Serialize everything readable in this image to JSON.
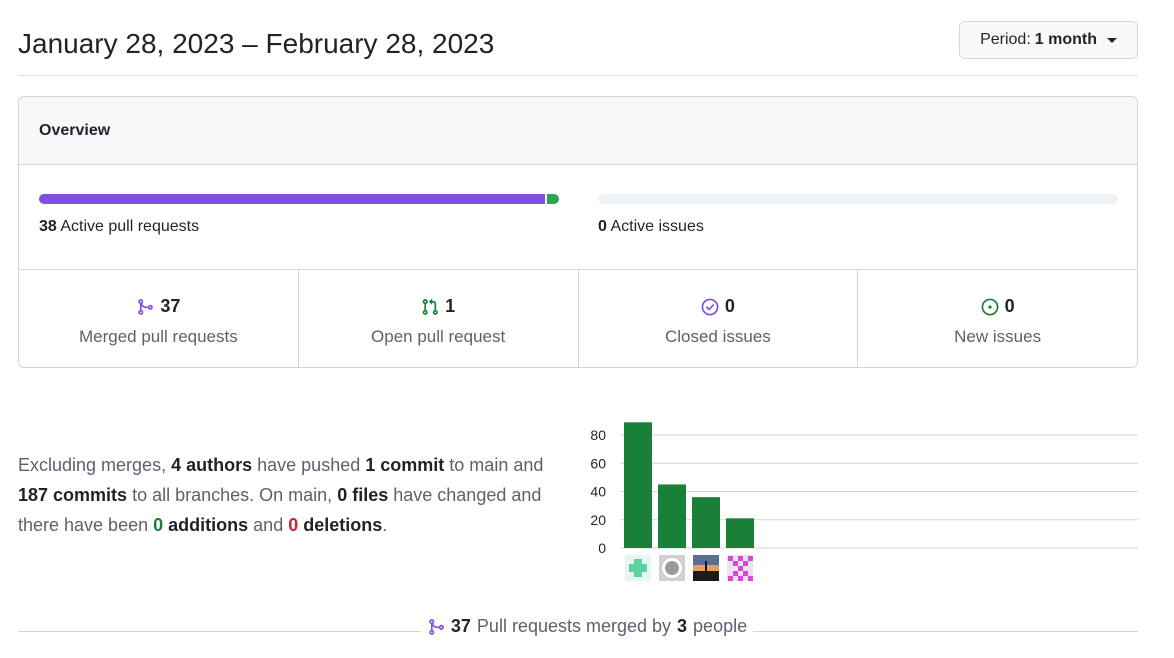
{
  "header": {
    "date_range": "January 28, 2023 – February 28, 2023",
    "period_prefix": "Period:",
    "period_value": "1 month"
  },
  "overview": {
    "title": "Overview",
    "pull_requests": {
      "count": "38",
      "label": "Active pull requests",
      "merged_fraction": 0.974,
      "open_fraction": 0.026
    },
    "issues": {
      "count": "0",
      "label": "Active issues",
      "fraction": 0
    },
    "stats": [
      {
        "icon": "git-merge-icon",
        "value": "37",
        "label": "Merged pull requests",
        "color": "#8250df"
      },
      {
        "icon": "git-pull-request-icon",
        "value": "1",
        "label": "Open pull request",
        "color": "#1a7f37"
      },
      {
        "icon": "issue-closed-icon",
        "value": "0",
        "label": "Closed issues",
        "color": "#8250df"
      },
      {
        "icon": "issue-opened-icon",
        "value": "0",
        "label": "New issues",
        "color": "#1a7f37"
      }
    ]
  },
  "summary": {
    "t1": "Excluding merges,",
    "authors": "4 authors",
    "t2": "have pushed",
    "commits_main": "1 commit",
    "t3": "to main and",
    "commits_all": "187 commits",
    "t4": "to all branches. On main,",
    "files": "0 files",
    "t5": "have changed and there have been",
    "additions_num": "0",
    "additions_word": "additions",
    "t6": "and",
    "deletions_num": "0",
    "deletions_word": "deletions",
    "t7": "."
  },
  "chart_data": {
    "type": "bar",
    "categories": [
      "author-1",
      "author-2",
      "author-3",
      "author-4"
    ],
    "values": [
      89,
      45,
      36,
      21
    ],
    "ylim": [
      0,
      80
    ],
    "yticks": [
      0,
      20,
      40,
      60,
      80
    ],
    "grid": true,
    "bar_color": "#1a7f37",
    "avatars": [
      "teal-cross-identicon",
      "github-octocat-avatar",
      "sunset-photo-avatar",
      "magenta-pattern-identicon"
    ]
  },
  "footer": {
    "count": "37",
    "t1": "Pull requests merged by",
    "people": "3",
    "t2": "people"
  }
}
